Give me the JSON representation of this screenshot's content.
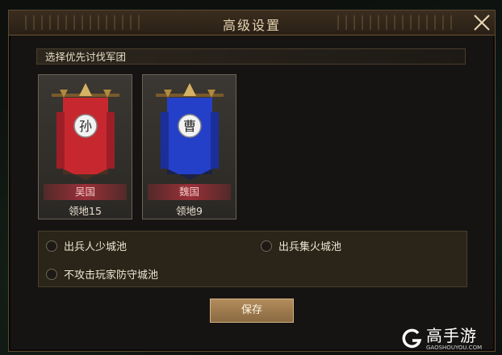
{
  "dialog": {
    "title": "高级设置",
    "section_label": "选择优先讨伐军团"
  },
  "armies": [
    {
      "emblem": "孙",
      "nation": "吴国",
      "territory": "领地15",
      "banner_color": "#c7282f"
    },
    {
      "emblem": "曹",
      "nation": "魏国",
      "territory": "领地9",
      "banner_color": "#2540c8"
    }
  ],
  "options": [
    {
      "label": "出兵人少城池",
      "checked": false
    },
    {
      "label": "出兵集火城池",
      "checked": false
    },
    {
      "label": "不攻击玩家防守城池",
      "checked": false
    }
  ],
  "buttons": {
    "save": "保存"
  },
  "watermark": {
    "title": "高手游",
    "url": "GAOSHOUYOU.COM"
  },
  "icons": [
    "close-icon",
    "g-logo-icon"
  ]
}
